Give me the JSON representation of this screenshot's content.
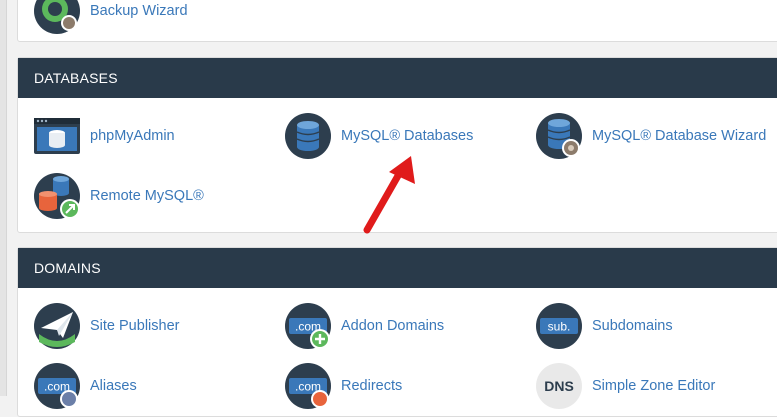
{
  "top_panel": {
    "items": [
      {
        "label": "Backup Wizard",
        "icon": "backup-wizard-icon"
      }
    ]
  },
  "databases": {
    "header": "DATABASES",
    "items": [
      {
        "label": "phpMyAdmin",
        "icon": "phpmyadmin-icon"
      },
      {
        "label": "MySQL® Databases",
        "icon": "mysql-databases-icon"
      },
      {
        "label": "MySQL® Database Wizard",
        "icon": "mysql-database-wizard-icon"
      },
      {
        "label": "Remote MySQL®",
        "icon": "remote-mysql-icon"
      }
    ]
  },
  "domains": {
    "header": "DOMAINS",
    "items": [
      {
        "label": "Site Publisher",
        "icon": "site-publisher-icon"
      },
      {
        "label": "Addon Domains",
        "icon": "addon-domains-icon",
        "icon_text": ".com"
      },
      {
        "label": "Subdomains",
        "icon": "subdomains-icon",
        "icon_text": "sub."
      },
      {
        "label": "Aliases",
        "icon": "aliases-icon",
        "icon_text": ".com"
      },
      {
        "label": "Redirects",
        "icon": "redirects-icon",
        "icon_text": ".com"
      },
      {
        "label": "Simple Zone Editor",
        "icon": "simple-zone-editor-icon",
        "icon_text": "DNS"
      }
    ]
  },
  "colors": {
    "header_bg": "#293a4a",
    "link": "#3a78b9",
    "icon_dark": "#2d3e4e",
    "accent_green": "#5cb85c",
    "accent_orange": "#e8643c",
    "arrow_red": "#e01b1b"
  }
}
